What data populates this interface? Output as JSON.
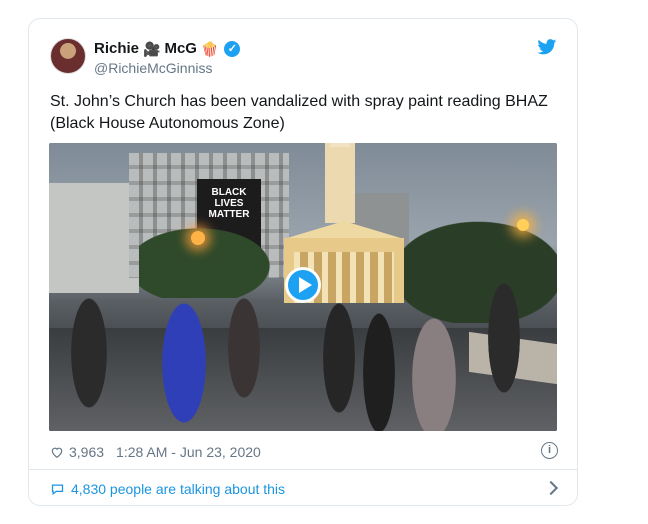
{
  "author": {
    "display_name": "Richie",
    "name_icon_1": "🎥",
    "display_name_2": "McG",
    "name_icon_2": "🍿",
    "handle": "@RichieMcGinniss",
    "verified": true
  },
  "tweet": {
    "text": "St. John’s Church has been vandalized with spray paint reading BHAZ (Black House Autonomous Zone)"
  },
  "media": {
    "type": "video",
    "banner_text": "BLACK LIVES MATTER"
  },
  "stats": {
    "likes": "3,963",
    "timestamp": "1:28 AM - Jun 23, 2020"
  },
  "conversation": {
    "label": "4,830 people are talking about this"
  },
  "icons": {
    "brand": "twitter-bird-icon",
    "like": "heart-icon",
    "info": "info-icon",
    "reply": "speech-bubble-icon",
    "chevron": "chevron-right-icon",
    "play": "play-icon"
  },
  "colors": {
    "brand": "#1da1f2",
    "link": "#1b95e0",
    "muted": "#657786",
    "border": "#e1e8ed"
  }
}
